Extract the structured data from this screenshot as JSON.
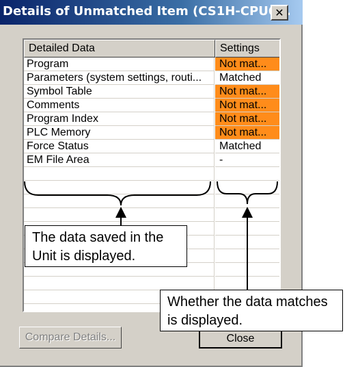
{
  "window": {
    "title": "Details of Unmatched Item (CS1H-CPU6...",
    "close_glyph": "✕"
  },
  "list": {
    "columns": [
      "Detailed Data",
      "Settings"
    ],
    "rows": [
      {
        "item": "Program",
        "setting": "Not mat...",
        "highlight": true
      },
      {
        "item": "Parameters (system settings, routi...",
        "setting": "Matched",
        "highlight": false
      },
      {
        "item": "Symbol Table",
        "setting": "Not mat...",
        "highlight": true
      },
      {
        "item": "Comments",
        "setting": "Not mat...",
        "highlight": true
      },
      {
        "item": "Program Index",
        "setting": "Not mat...",
        "highlight": true
      },
      {
        "item": "PLC Memory",
        "setting": "Not mat...",
        "highlight": true
      },
      {
        "item": "Force Status",
        "setting": "Matched",
        "highlight": false
      },
      {
        "item": "EM File Area",
        "setting": "-",
        "highlight": false
      }
    ]
  },
  "callouts": {
    "data": "The data saved in the Unit is displayed.",
    "match": "Whether the data matches is displayed."
  },
  "buttons": {
    "compare": "Compare Details...",
    "close": "Close"
  },
  "colors": {
    "highlight": "#ff8c1a",
    "title_bar": "#0a246a"
  }
}
